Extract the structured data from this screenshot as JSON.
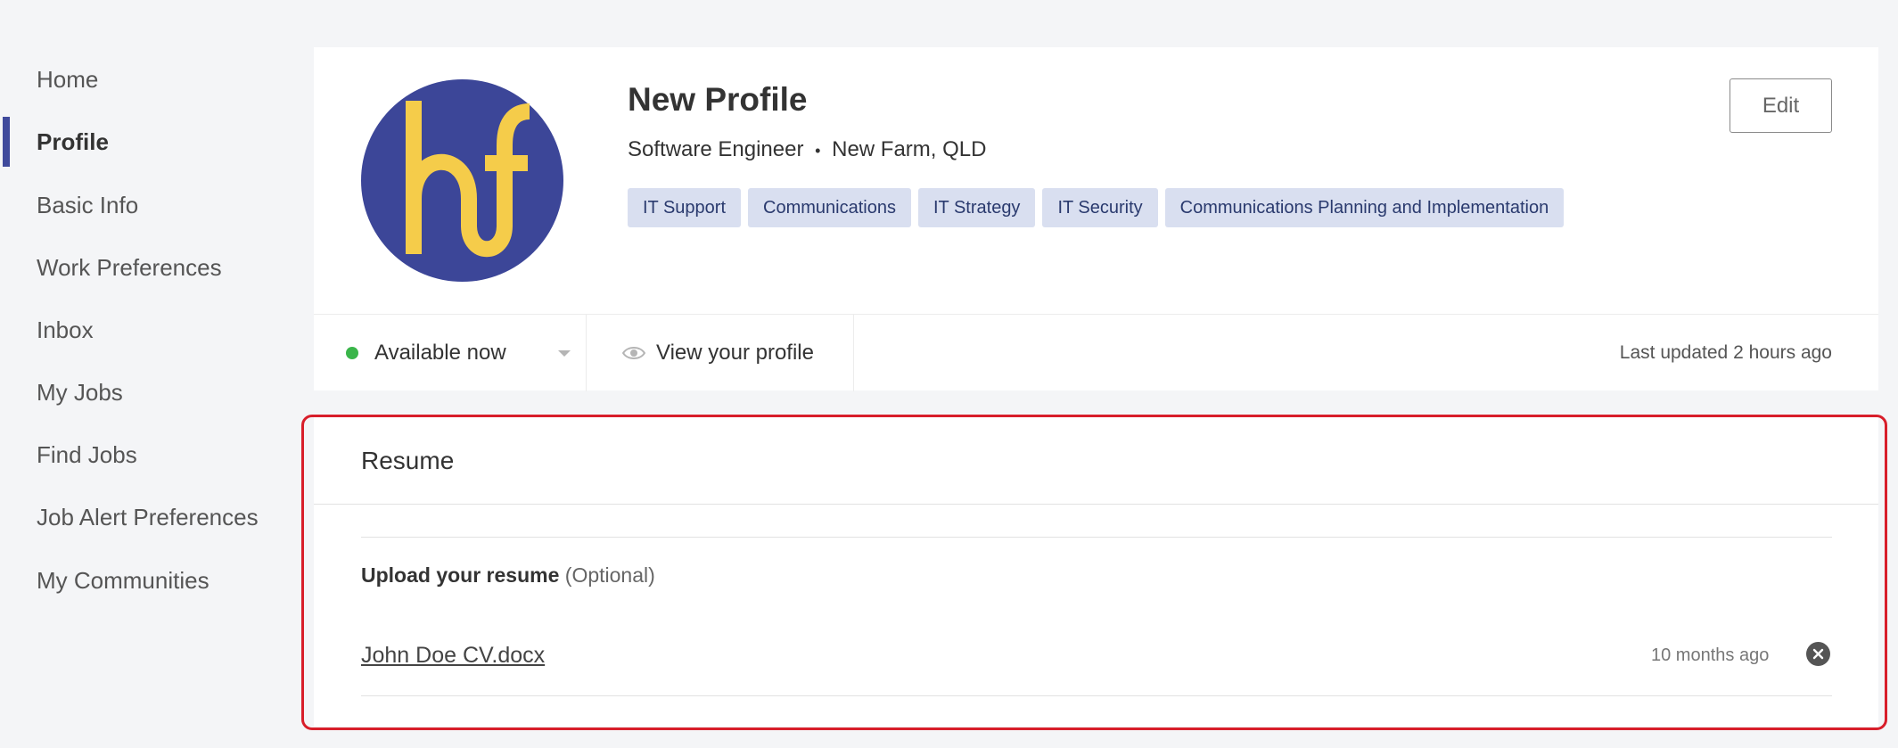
{
  "sidebar": {
    "items": [
      {
        "label": "Home",
        "active": false
      },
      {
        "label": "Profile",
        "active": true
      },
      {
        "label": "Basic Info",
        "active": false
      },
      {
        "label": "Work Preferences",
        "active": false
      },
      {
        "label": "Inbox",
        "active": false
      },
      {
        "label": "My Jobs",
        "active": false
      },
      {
        "label": "Find Jobs",
        "active": false
      },
      {
        "label": "Job Alert Preferences",
        "active": false
      },
      {
        "label": "My Communities",
        "active": false
      }
    ]
  },
  "profile": {
    "name": "New Profile",
    "title": "Software Engineer",
    "separator": "•",
    "location": "New Farm, QLD",
    "tags": [
      "IT Support",
      "Communications",
      "IT Strategy",
      "IT Security",
      "Communications Planning and Implementation"
    ],
    "edit_label": "Edit",
    "avatar_icon": "hf-logo",
    "availability": "Available now",
    "view_profile_label": "View your profile",
    "last_updated": "Last updated 2 hours ago"
  },
  "resume": {
    "heading": "Resume",
    "upload_label": "Upload your resume",
    "upload_optional": "(Optional)",
    "file_name": "John Doe CV.docx",
    "file_time": "10 months ago",
    "remove_icon": "close-circle-icon"
  },
  "colors": {
    "accent": "#3f4a9c",
    "avatar_bg": "#3c4698",
    "avatar_fg": "#f5cc4a",
    "tag_bg": "#d9dff0",
    "available": "#3ab54a",
    "highlight": "#d81e2a"
  }
}
